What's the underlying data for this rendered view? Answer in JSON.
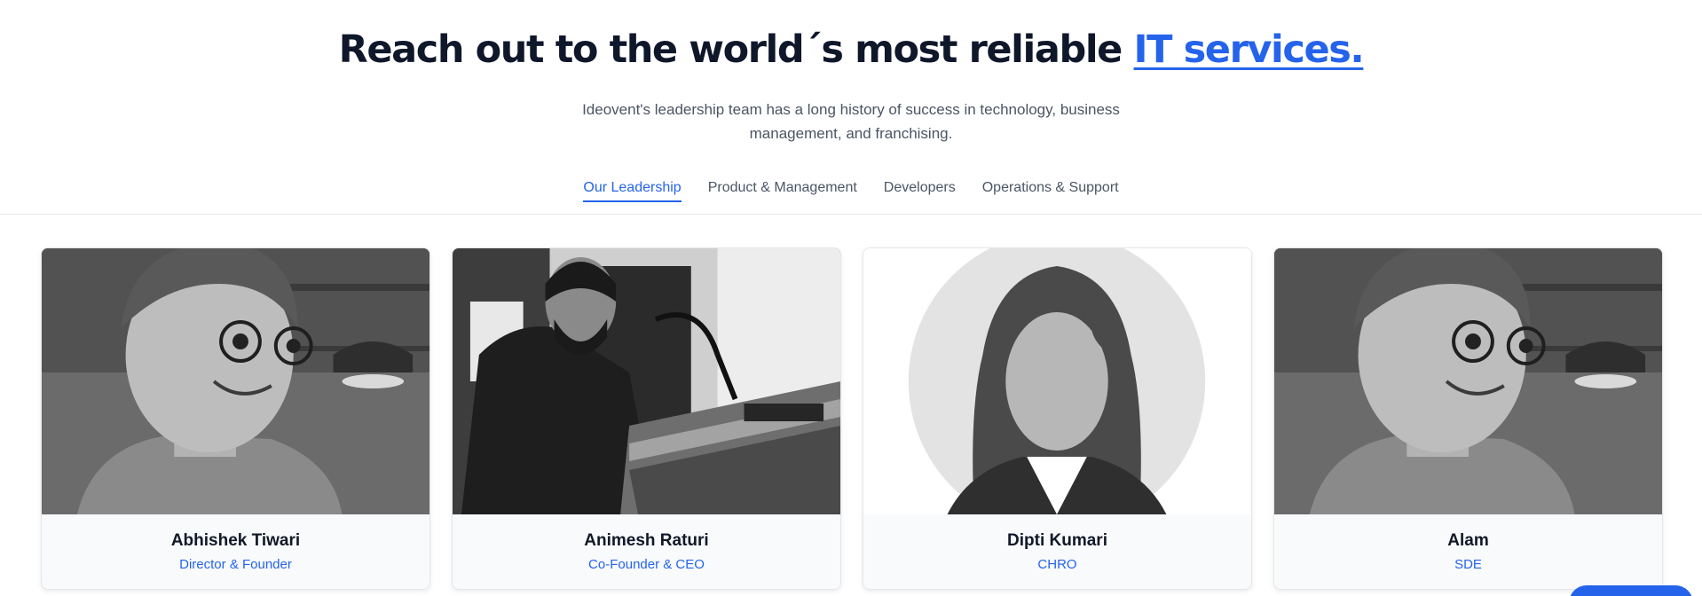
{
  "hero": {
    "title_main": "Reach out to the world´s most reliable ",
    "title_accent": "IT services.",
    "subtitle": "Ideovent's leadership team has a long history of success in technology, business management, and franchising."
  },
  "tabs": [
    {
      "label": "Our Leadership",
      "active": true
    },
    {
      "label": "Product & Management",
      "active": false
    },
    {
      "label": "Developers",
      "active": false
    },
    {
      "label": "Operations & Support",
      "active": false
    }
  ],
  "members": [
    {
      "name": "Abhishek Tiwari",
      "role": "Director & Founder",
      "photo": "cartoon-man-portrait"
    },
    {
      "name": "Animesh Raturi",
      "role": "Co-Founder & CEO",
      "photo": "man-at-podium-photo"
    },
    {
      "name": "Dipti Kumari",
      "role": "CHRO",
      "photo": "female-avatar-placeholder"
    },
    {
      "name": "Alam",
      "role": "SDE",
      "photo": "cartoon-man-portrait"
    }
  ],
  "colors": {
    "accent": "#2563eb",
    "heading": "#0f172a",
    "muted": "#4b5563"
  }
}
